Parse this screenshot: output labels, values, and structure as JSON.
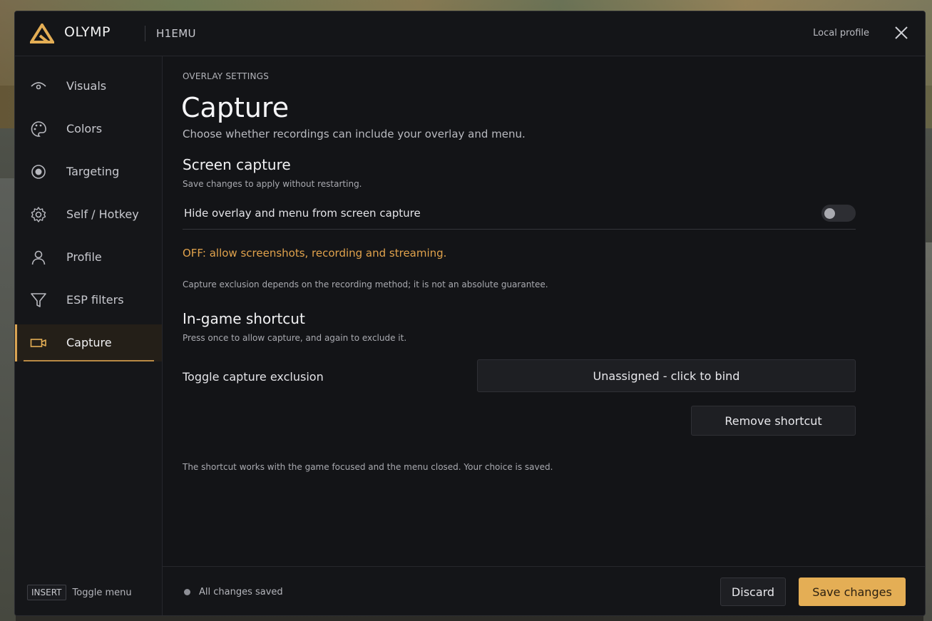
{
  "app": {
    "brand": "OLYMP",
    "game": "H1EMU",
    "profile_label": "Local profile",
    "accent_color": "#e4ae55"
  },
  "sidebar": {
    "items": [
      {
        "label": "Visuals",
        "icon": "eye-icon"
      },
      {
        "label": "Colors",
        "icon": "palette-icon"
      },
      {
        "label": "Targeting",
        "icon": "target-icon"
      },
      {
        "label": "Self / Hotkey",
        "icon": "gear-icon"
      },
      {
        "label": "Profile",
        "icon": "user-icon"
      },
      {
        "label": "ESP filters",
        "icon": "filter-icon"
      },
      {
        "label": "Capture",
        "icon": "camera-icon",
        "active": true
      }
    ],
    "hint_key": "INSERT",
    "hint_text": "Toggle menu"
  },
  "main": {
    "eyebrow": "OVERLAY SETTINGS",
    "title": "Capture",
    "description": "Choose whether recordings can include your overlay and menu.",
    "screen_capture": {
      "title": "Screen capture",
      "subtitle": "Save changes to apply without restarting.",
      "toggle_label": "Hide overlay and menu from screen capture",
      "toggle_on": false,
      "status": "OFF: allow screenshots, recording and streaming.",
      "note": "Capture exclusion depends on the recording method; it is not an absolute guarantee."
    },
    "shortcut": {
      "title": "In-game shortcut",
      "subtitle": "Press once to allow capture, and again to exclude it.",
      "bind_label": "Toggle capture exclusion",
      "bind_button": "Unassigned - click to bind",
      "remove_button": "Remove shortcut",
      "note": "The shortcut works with the game focused and the menu closed. Your choice is saved."
    }
  },
  "footer": {
    "status": "All changes saved",
    "discard": "Discard",
    "save": "Save changes"
  }
}
